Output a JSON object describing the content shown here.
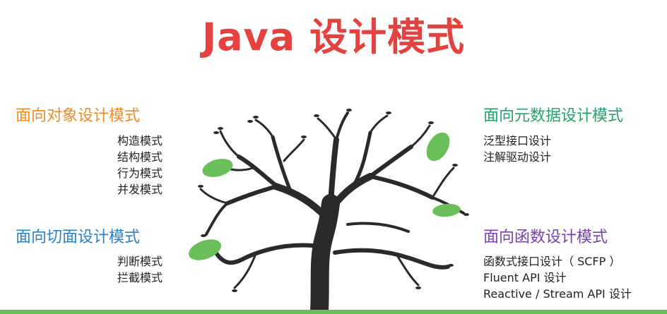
{
  "title": "Java 设计模式",
  "colors": {
    "title": "#e5423f",
    "oop": "#f08a24",
    "aop": "#2a7fc9",
    "meta": "#22a36b",
    "fn": "#7a3fb0",
    "leaf": "#6bbf5a",
    "ground": "#6bbf5a"
  },
  "sections": {
    "oop": {
      "heading": "面向对象设计模式",
      "items": [
        "构造模式",
        "结构模式",
        "行为模式",
        "并发模式"
      ]
    },
    "aop": {
      "heading": "面向切面设计模式",
      "items": [
        "判断模式",
        "拦截模式"
      ]
    },
    "meta": {
      "heading": "面向元数据设计模式",
      "items": [
        "泛型接口设计",
        "注解驱动设计"
      ]
    },
    "fn": {
      "heading": "面向函数设计模式",
      "items": [
        "函数式接口设计（ SCFP ）",
        "Fluent API 设计",
        "Reactive / Stream API 设计"
      ]
    }
  }
}
